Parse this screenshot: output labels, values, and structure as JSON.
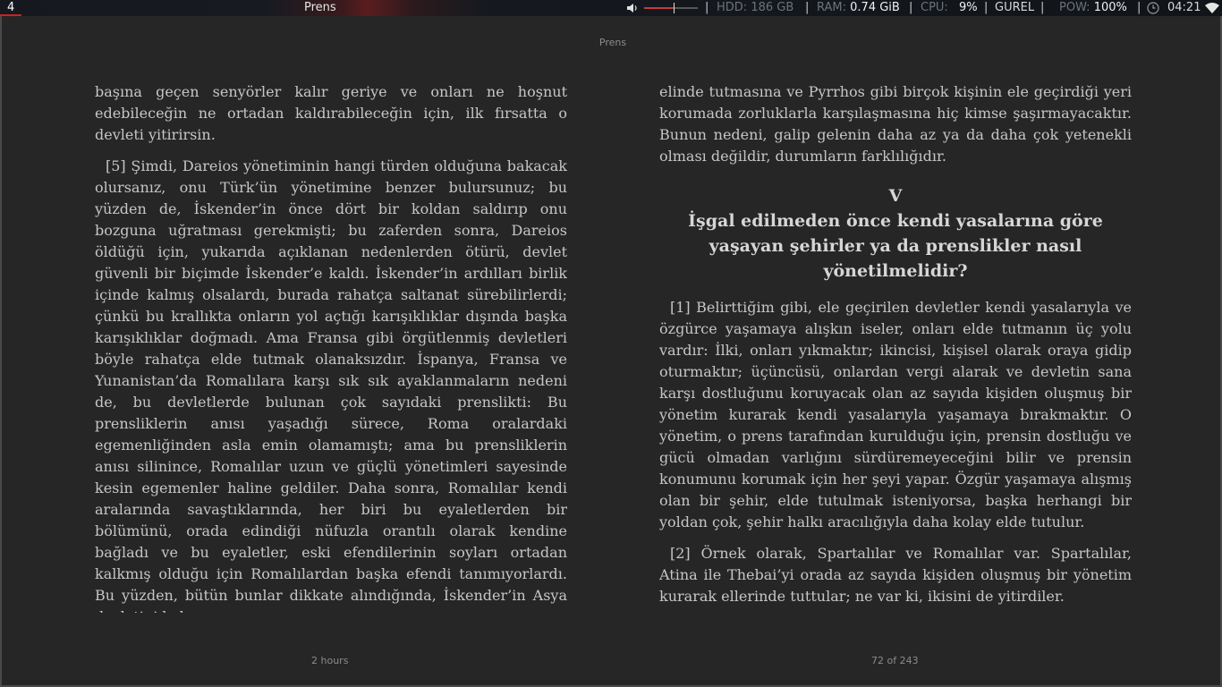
{
  "topbar": {
    "workspace": "4",
    "window_title": "Prens",
    "volume_level": 0.55,
    "hdd_label": "HDD:",
    "hdd_value": "186 GB",
    "ram_label": "RAM:",
    "ram_value": "0.74 GiB",
    "cpu_label": "CPU:",
    "cpu_value": "9%",
    "user": "GUREL",
    "pow_label": "POW:",
    "pow_value": "100%",
    "time": "04:21",
    "separator": "|",
    "icons": [
      "speaker-icon",
      "clock-icon",
      "wifi-icon"
    ],
    "accent_color": "#d02020"
  },
  "reader": {
    "header_title": "Prens",
    "footer_left": "2 hours",
    "footer_right": "72 of 243",
    "left_page": {
      "p1": "başına geçen senyörler kalır geriye ve onları ne hoşnut edebileceğin ne ortadan kaldırabileceğin için, ilk fırsatta o devleti yitirirsin.",
      "p2": "[5] Şimdi, Dareios yönetiminin hangi türden olduğuna bakacak olursanız, onu Türk’ün yönetimine benzer bulursunuz; bu yüzden de, İskender’in önce dört bir koldan saldırıp onu bozguna uğratması gerekmişti; bu zaferden sonra, Dareios öldüğü için, yukarıda açıklanan nedenlerden ötürü, devlet güvenli bir biçimde İskender’e kaldı. İskender’in ardılları birlik içinde kalmış olsalardı, burada rahatça saltanat sürebilirlerdi; çünkü bu krallıkta onların yol açtığı karışıklıklar dışında başka karışıklıklar doğmadı. Ama Fransa gibi örgütlenmiş devletleri böyle rahatça elde tutmak olanaksızdır. İspanya, Fransa ve Yunanistan’da Romalılara karşı sık sık ayaklanmaların nedeni de, bu devletlerde bulunan çok sayıdaki prenslikti: Bu prensliklerin anısı yaşadığı sürece, Roma oralardaki egemenliğinden asla emin olamamıştı; ama bu prensliklerin anısı silinince, Romalılar uzun ve güçlü yönetimleri sayesinde kesin egemenler haline geldiler. Daha sonra, Romalılar kendi aralarında savaştıklarında, her biri bu eyaletlerden bir bölümünü, orada edindiği nüfuzla orantılı olarak kendine bağladı ve bu eyaletler, eski efendilerinin soyları ortadan kalkmış olduğu için Romalılardan başka efendi tanımıyorlardı. Bu yüzden, bütün bunlar dikkate alındığında, İskender’in Asya devletini kolayca"
    },
    "right_page": {
      "p1": "elinde tutmasına ve Pyrrhos gibi birçok kişinin ele geçirdiği yeri korumada zorluklarla karşılaşmasına hiç kimse şaşırmayacaktır. Bunun nedeni, galip gelenin daha az ya da daha çok yetenekli olması değildir, durumların farklılığıdır.",
      "chapter_number": "V",
      "chapter_title": "İşgal edilmeden önce kendi yasalarına göre yaşayan şehirler ya da prenslikler nasıl yönetilmelidir?",
      "p2": "[1] Belirttiğim gibi, ele geçirilen devletler kendi yasalarıyla ve özgürce yaşamaya alışkın iseler, onları elde tutmanın üç yolu vardır: İlki, onları yıkmaktır; ikincisi, kişisel olarak oraya gidip oturmaktır; üçüncüsü, onlardan vergi alarak ve devletin sana karşı dostluğunu koruyacak olan az sayıda kişiden oluşmuş bir yönetim kurarak kendi yasalarıyla yaşamaya bırakmaktır. O yönetim, o prens tarafından kurulduğu için, prensin dostluğu ve gücü olmadan varlığını sürdüremeyeceğini bilir ve prensin konumunu korumak için her şeyi yapar. Özgür yaşamaya alışmış olan bir şehir, elde tutulmak isteniyorsa, başka herhangi bir yoldan çok, şehir halkı aracılığıyla daha kolay elde tutulur.",
      "p3": "[2] Örnek olarak, Spartalılar ve Romalılar var. Spartalılar, Atina ile Thebai’yi orada az sayıda kişiden oluşmuş bir yönetim kurarak ellerinde tuttular; ne var ki, ikisini de yitirdiler."
    }
  }
}
